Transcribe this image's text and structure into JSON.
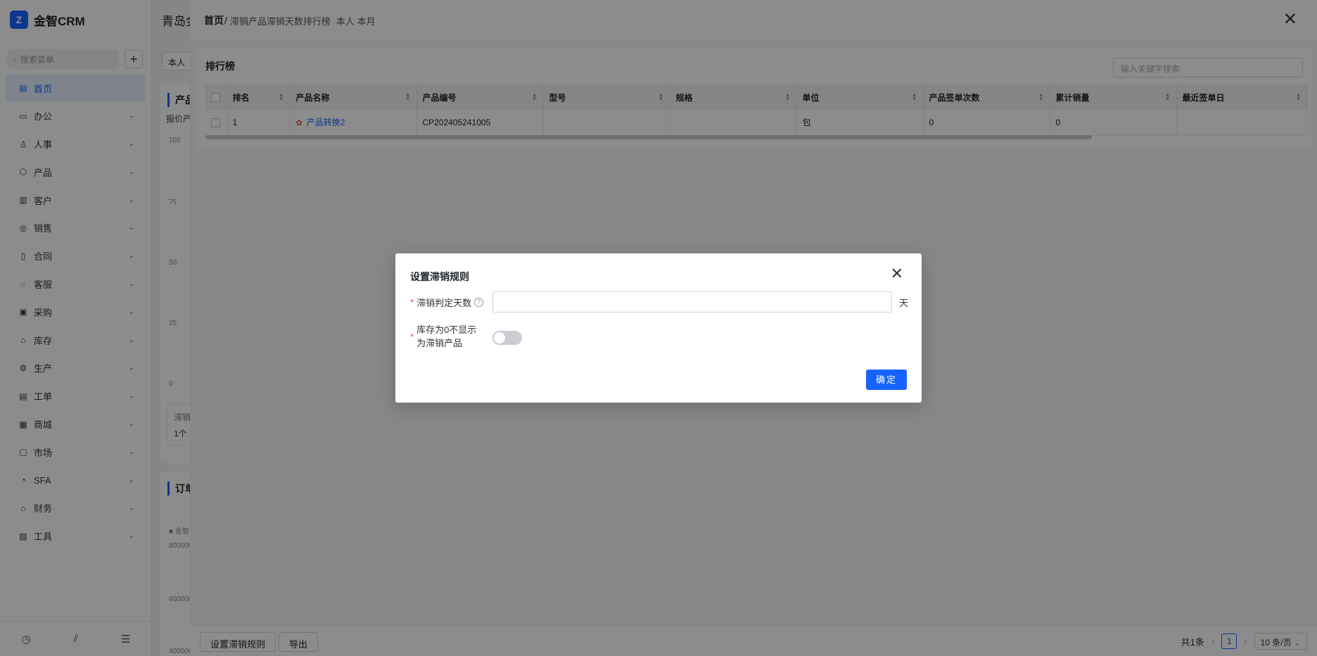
{
  "app": {
    "name": "金智CRM",
    "logo_text": "Z"
  },
  "sidebar": {
    "search_placeholder": "搜索菜单",
    "add_label": "+",
    "items": [
      {
        "label": "首页",
        "icon": "home-icon",
        "glyph": "▤",
        "active": true
      },
      {
        "label": "办公",
        "icon": "office-icon",
        "glyph": "▭"
      },
      {
        "label": "人事",
        "icon": "people-icon",
        "glyph": "♙"
      },
      {
        "label": "产品",
        "icon": "product-icon",
        "glyph": "⬡"
      },
      {
        "label": "客户",
        "icon": "customer-icon",
        "glyph": "▥"
      },
      {
        "label": "销售",
        "icon": "sales-icon",
        "glyph": "◎"
      },
      {
        "label": "合同",
        "icon": "contract-icon",
        "glyph": "▯"
      },
      {
        "label": "客服",
        "icon": "service-icon",
        "glyph": "◌"
      },
      {
        "label": "采购",
        "icon": "purchase-icon",
        "glyph": "▣"
      },
      {
        "label": "库存",
        "icon": "inventory-icon",
        "glyph": "⌂"
      },
      {
        "label": "生产",
        "icon": "production-icon",
        "glyph": "⚙"
      },
      {
        "label": "工单",
        "icon": "ticket-icon",
        "glyph": "▤"
      },
      {
        "label": "商城",
        "icon": "mall-icon",
        "glyph": "▦"
      },
      {
        "label": "市场",
        "icon": "market-icon",
        "glyph": "▢"
      },
      {
        "label": "SFA",
        "icon": "sfa-icon",
        "glyph": "◔"
      },
      {
        "label": "财务",
        "icon": "finance-icon",
        "glyph": "⌂"
      },
      {
        "label": "工具",
        "icon": "tool-icon",
        "glyph": "▧"
      }
    ],
    "footer": {
      "history_glyph": "◷",
      "stats_glyph": "⫽",
      "menu_glyph": "☰"
    }
  },
  "background": {
    "title": "青岛金",
    "filter_label": "本人",
    "card_title": "产品",
    "card_sub": "报价产",
    "ticks": [
      "100",
      "75",
      "50",
      "25",
      "0"
    ],
    "stat_label": "滞销",
    "stat_value": "1个",
    "card2_title": "订单",
    "legend": "金智",
    "ticks2": [
      "800000",
      "600000",
      "400000"
    ]
  },
  "drawer": {
    "breadcrumb_home": "首页",
    "breadcrumb_sep": "/",
    "breadcrumb_current": "滞销产品滞销天数排行榜",
    "filter_tags": "本人 本月",
    "close_glyph": "✕",
    "panel_title": "排行榜",
    "search_placeholder": "输入关键字搜索",
    "columns": [
      "排名",
      "产品名称",
      "产品编号",
      "型号",
      "规格",
      "单位",
      "产品签单次数",
      "累计销量",
      "最近签单日"
    ],
    "rows": [
      {
        "rank": "1",
        "name": "产品转换2",
        "code": "CP202405241005",
        "model": "",
        "spec": "",
        "unit": "包",
        "sign_count": "0",
        "total_sales": "0",
        "last_date": ""
      }
    ],
    "footer": {
      "btn_rule": "设置滞销规则",
      "btn_export": "导出",
      "total": "共1条",
      "page": "1",
      "page_size": "10 条/页"
    }
  },
  "modal": {
    "title": "设置滞销规则",
    "close_glyph": "✕",
    "field1_label": "滞销判定天数",
    "field1_help": "?",
    "field1_value": "",
    "field1_unit": "天",
    "field2_label": "库存为0不显示为滞销产品",
    "field2_on": false,
    "confirm_label": "确定",
    "required_mark": "*"
  }
}
